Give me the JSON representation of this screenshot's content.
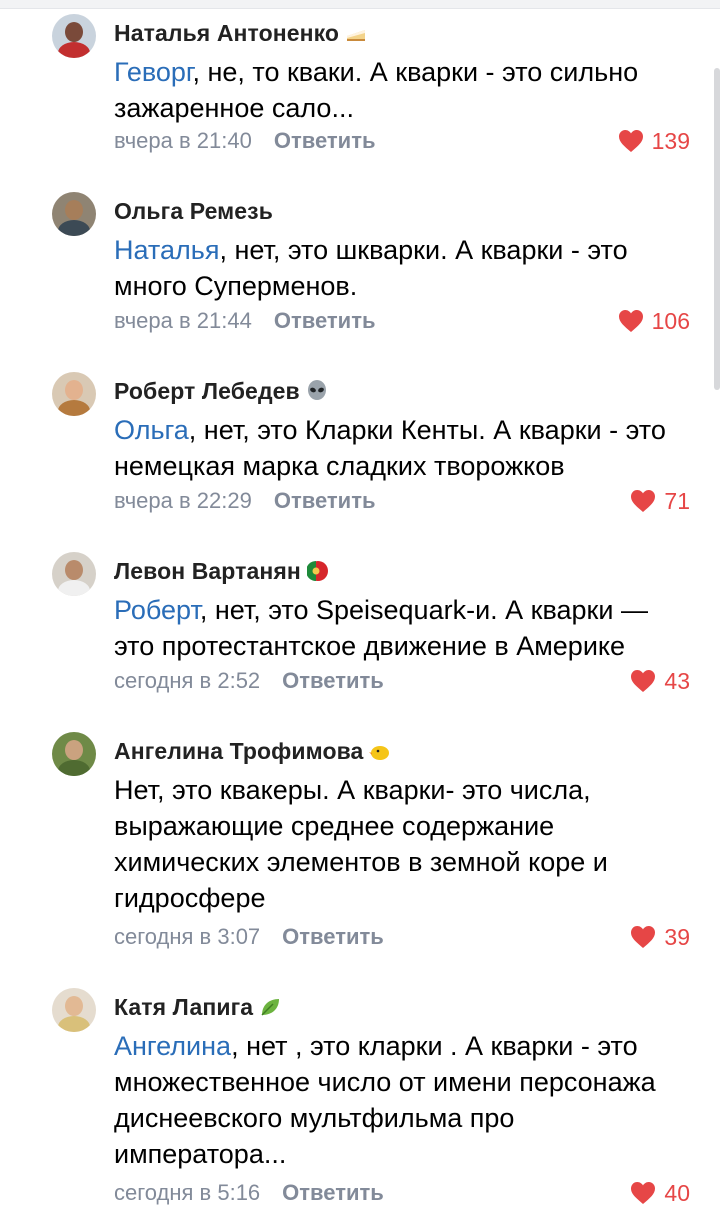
{
  "reply_label": "Ответить",
  "comments": [
    {
      "author": "Наталья Антоненко",
      "badge": "cake-emoji",
      "reply_to": "Геворг",
      "text": ", не, то кваки. А кварки - это сильно зажаренное сало...",
      "time": "вчера в 21:40",
      "likes": "139"
    },
    {
      "author": "Ольга Ремезь",
      "badge": "",
      "reply_to": "Наталья",
      "text": ", нет, это шкварки. А кварки - это много Суперменов.",
      "time": "вчера в 21:44",
      "likes": "106"
    },
    {
      "author": "Роберт Лебедев",
      "badge": "alien-emoji",
      "reply_to": "Ольга",
      "text": ", нет, это Кларки Кенты. А кварки - это немецкая марка сладких творожков",
      "time": "вчера в 22:29",
      "likes": "71"
    },
    {
      "author": "Левон Вартанян",
      "badge": "portugal-flag-emoji",
      "reply_to": "Роберт",
      "text": ", нет, это Speisequark-и. А кварки — это протестантское движение в Америке",
      "time": "сегодня в 2:52",
      "likes": "43"
    },
    {
      "author": "Ангелина Трофимова",
      "badge": "chick-emoji",
      "reply_to": "",
      "text": "Нет, это квакеры. А кварки- это числа, выражающие среднее содержание химических элементов в земной коре и гидросфере",
      "time": "сегодня в 3:07",
      "likes": "39"
    },
    {
      "author": "Катя Лапига",
      "badge": "leaf-emoji",
      "reply_to": "Ангелина",
      "text": ", нет , это кларки . А кварки - это множественное число от имени персонажа диснеевского мультфильма про императора...",
      "time": "сегодня в 5:16",
      "likes": "40"
    }
  ],
  "colors": {
    "link": "#2a6db8",
    "meta": "#828a99",
    "like": "#e64646"
  }
}
